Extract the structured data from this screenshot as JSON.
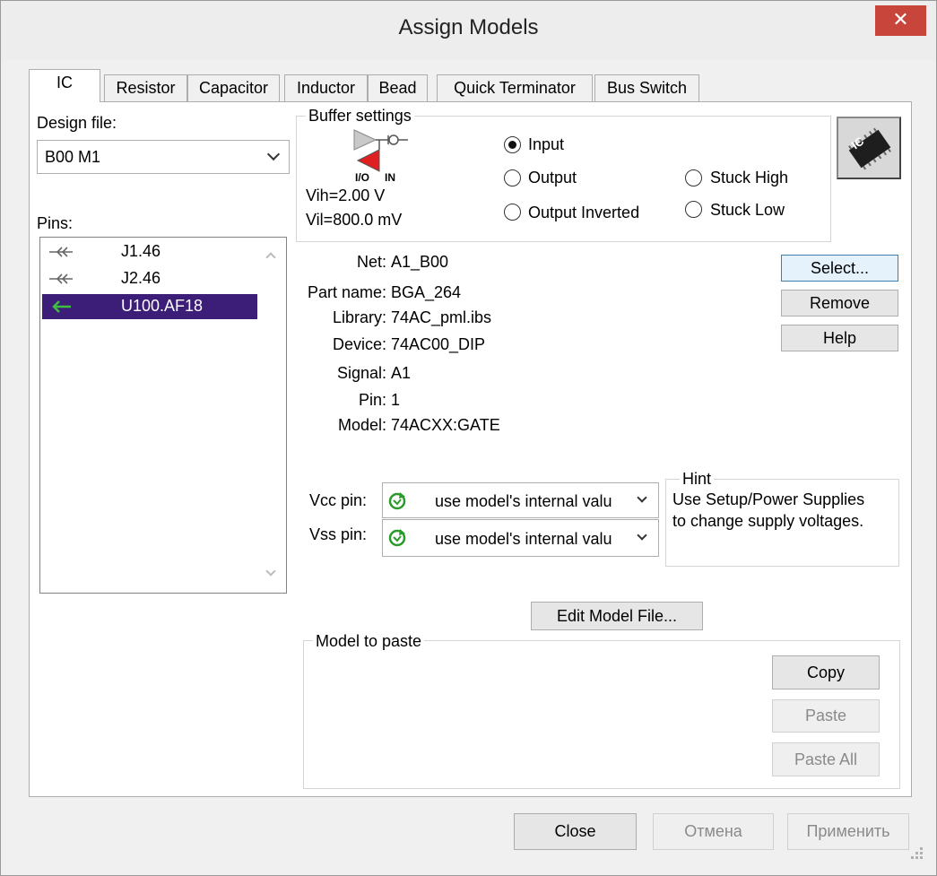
{
  "window": {
    "title": "Assign Models",
    "close_glyph": "✕"
  },
  "tabs": [
    {
      "label": "IC"
    },
    {
      "label": "Resistor"
    },
    {
      "label": "Capacitor"
    },
    {
      "label": "Inductor"
    },
    {
      "label": "Bead"
    },
    {
      "label": "Quick Terminator"
    },
    {
      "label": "Bus Switch"
    }
  ],
  "design_file": {
    "label": "Design file:",
    "value": "B00 M1"
  },
  "pins": {
    "label": "Pins:",
    "items": [
      {
        "name": "J1.46",
        "icon": "bidirectional-pin-icon",
        "selected": false
      },
      {
        "name": "J2.46",
        "icon": "bidirectional-pin-icon",
        "selected": false
      },
      {
        "name": "U100.AF18",
        "icon": "input-pin-arrow-icon",
        "selected": true
      }
    ]
  },
  "buffer": {
    "title": "Buffer settings",
    "io_label": "I/O",
    "in_label": "IN",
    "vih": "Vih=2.00 V",
    "vil": "Vil=800.0 mV",
    "options": [
      {
        "label": "Input",
        "checked": true
      },
      {
        "label": "Output",
        "checked": false
      },
      {
        "label": "Output Inverted",
        "checked": false
      },
      {
        "label": "Stuck High",
        "checked": false
      },
      {
        "label": "Stuck Low",
        "checked": false
      }
    ]
  },
  "ic_icon_label": "IC",
  "details": {
    "net": {
      "label": "Net:",
      "value": "A1_B00"
    },
    "part_name": {
      "label": "Part name:",
      "value": "BGA_264"
    },
    "library": {
      "label": "Library:",
      "value": "74AC_pml.ibs"
    },
    "device": {
      "label": "Device:",
      "value": "74AC00_DIP"
    },
    "signal": {
      "label": "Signal:",
      "value": "A1"
    },
    "pin": {
      "label": "Pin:",
      "value": "1"
    },
    "model": {
      "label": "Model:",
      "value": "74ACXX:GATE"
    }
  },
  "side_buttons": {
    "select": "Select...",
    "remove": "Remove",
    "help": "Help"
  },
  "supply": {
    "vcc_label": "Vcc pin:",
    "vcc_value": "use model's internal valu",
    "vss_label": "Vss pin:",
    "vss_value": "use model's internal valu"
  },
  "hint": {
    "title": "Hint",
    "line1": "Use Setup/Power Supplies",
    "line2": "to change supply voltages."
  },
  "edit_model_button": "Edit Model File...",
  "model_to_paste": {
    "title": "Model to paste",
    "copy": "Copy",
    "paste": "Paste",
    "paste_all": "Paste All"
  },
  "footer": {
    "close": "Close",
    "cancel": "Отмена",
    "apply": "Применить"
  }
}
